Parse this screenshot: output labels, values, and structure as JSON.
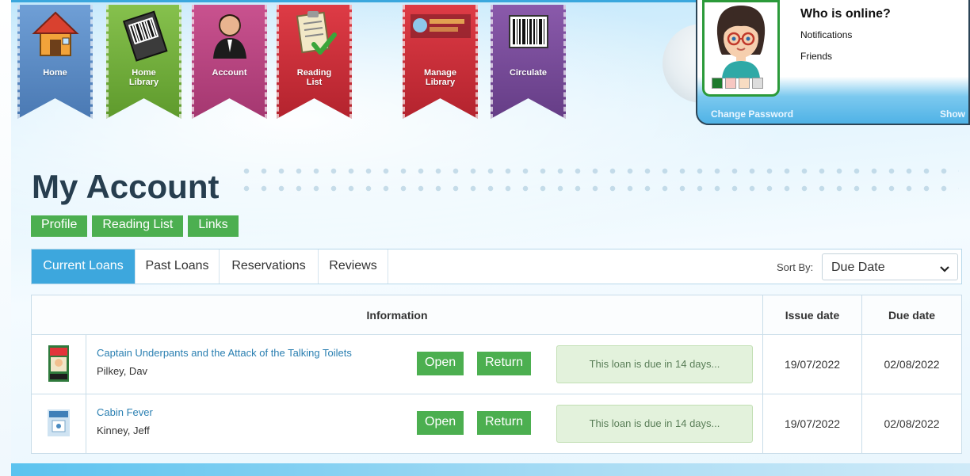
{
  "nav": {
    "items": [
      {
        "label": "Home",
        "color": "#5b8fc9",
        "icon": "house-icon"
      },
      {
        "label": "Home\nLibrary",
        "color": "#72ab3e",
        "icon": "barcode-book-icon"
      },
      {
        "label": "Account",
        "color": "#b8457f",
        "icon": "user-icon"
      },
      {
        "label": "Reading\nList",
        "color": "#c9303a",
        "icon": "checklist-icon"
      },
      {
        "label": "Manage\nLibrary",
        "color": "#c9303a",
        "icon": "library-logo-icon"
      },
      {
        "label": "Circulate",
        "color": "#7b4d9c",
        "icon": "barcode-icon"
      }
    ]
  },
  "online_panel": {
    "title": "Who is online?",
    "notifications": "Notifications",
    "friends": "Friends",
    "change_password": "Change Password",
    "show": "Show",
    "swatch_colors": [
      "#1e7a2d",
      "#f7c7c2",
      "#f7dcc2",
      "#dddddd"
    ]
  },
  "page": {
    "title": "My Account"
  },
  "subnav": {
    "profile": "Profile",
    "reading_list": "Reading List",
    "links": "Links"
  },
  "tabs": {
    "current_loans": "Current Loans",
    "past_loans": "Past Loans",
    "reservations": "Reservations",
    "reviews": "Reviews",
    "active": "Current Loans"
  },
  "sort": {
    "label": "Sort By:",
    "value": "Due Date"
  },
  "table": {
    "headers": {
      "information": "Information",
      "issue_date": "Issue date",
      "due_date": "Due date"
    },
    "rows": [
      {
        "title": "Captain Underpants and the Attack of the Talking Toilets",
        "author": "Pilkey, Dav",
        "open": "Open",
        "return": "Return",
        "status": "This loan is due in 14 days...",
        "issue_date": "19/07/2022",
        "due_date": "02/08/2022"
      },
      {
        "title": "Cabin Fever",
        "author": "Kinney, Jeff",
        "open": "Open",
        "return": "Return",
        "status": "This loan is due in 14 days...",
        "issue_date": "19/07/2022",
        "due_date": "02/08/2022"
      }
    ]
  },
  "colors": {
    "accent_green": "#4caf50",
    "accent_blue": "#3da7dd",
    "title_color": "#273e4f"
  }
}
